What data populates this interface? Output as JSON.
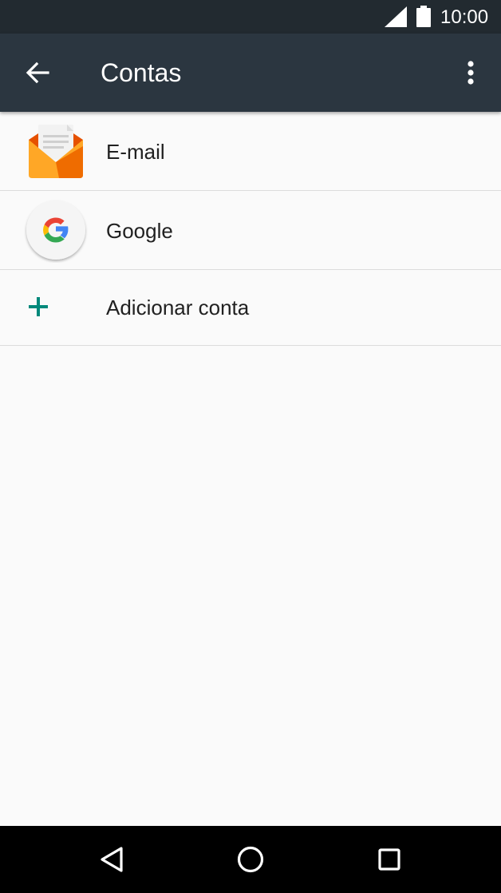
{
  "status_bar": {
    "time": "10:00",
    "icons": [
      "signal-icon",
      "battery-icon"
    ]
  },
  "app_bar": {
    "title": "Contas",
    "back_icon": "arrow-back-icon",
    "menu_icon": "more-vert-icon",
    "background": "#2b3640"
  },
  "accounts": {
    "items": [
      {
        "label": "E-mail",
        "icon": "email-app-icon"
      },
      {
        "label": "Google",
        "icon": "google-icon"
      }
    ],
    "add": {
      "label": "Adicionar conta",
      "icon": "plus-icon",
      "accent": "#00897b"
    }
  },
  "nav_bar": {
    "icons": [
      "nav-back-icon",
      "nav-home-icon",
      "nav-recents-icon"
    ]
  }
}
